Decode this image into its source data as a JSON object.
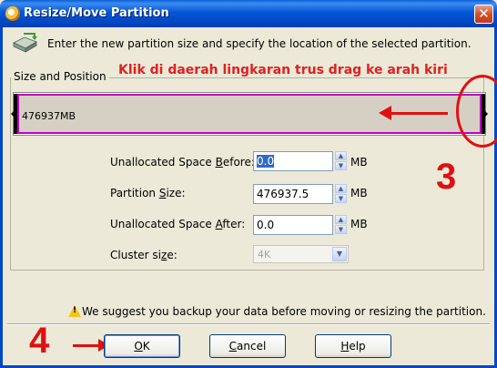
{
  "window": {
    "title": "Resize/Move Partition",
    "close_glyph": "✕"
  },
  "header": {
    "instruction": "Enter the new partition size and specify the location of the selected partition."
  },
  "group": {
    "label": "Size and Position"
  },
  "annotation": {
    "text": "Klik di daerah lingkaran trus drag ke arah kiri",
    "step3": "3",
    "step4": "4"
  },
  "partition": {
    "size_label": "476937MB"
  },
  "fields": {
    "before": {
      "label_pre": "Unallocated Space ",
      "label_key": "B",
      "label_post": "efore:",
      "value": "0.0",
      "unit": "MB"
    },
    "size": {
      "label_pre": "Partition ",
      "label_key": "S",
      "label_post": "ize:",
      "value": "476937.5",
      "unit": "MB"
    },
    "after": {
      "label_pre": "Unallocated Space ",
      "label_key": "A",
      "label_post": "fter:",
      "value": "0.0",
      "unit": "MB"
    },
    "cluster": {
      "label_pre": "Cluster si",
      "label_key": "z",
      "label_post": "e:",
      "value": "4K"
    }
  },
  "warning": {
    "text": "We suggest you backup your data before moving or resizing the partition."
  },
  "buttons": {
    "ok": {
      "pre": "",
      "key": "O",
      "post": "K"
    },
    "cancel": {
      "pre": "",
      "key": "C",
      "post": "ancel"
    },
    "help": {
      "pre": "",
      "key": "H",
      "post": "elp"
    }
  },
  "colors": {
    "titlebar": "#0556d6",
    "annotation": "#e01010",
    "partition_border": "#c000c0"
  },
  "icons": {
    "app": "partition-tool-icon",
    "header": "drive-icon",
    "warning": "warning-icon"
  }
}
